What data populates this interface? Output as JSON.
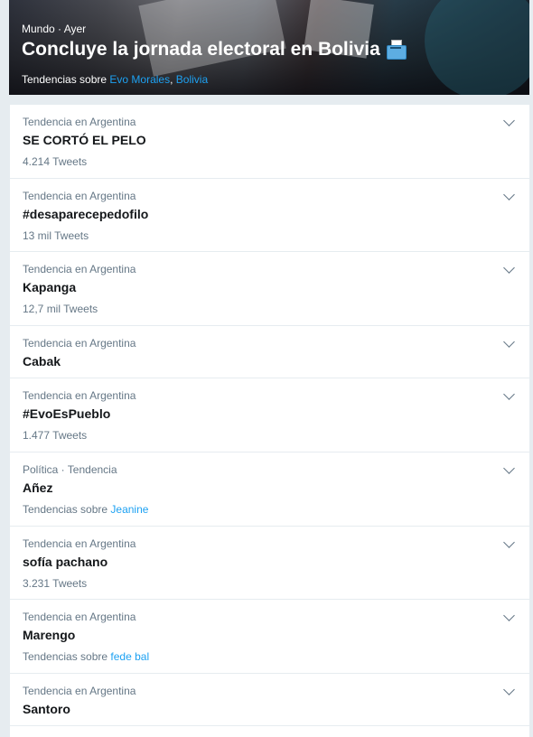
{
  "hero": {
    "category": "Mundo",
    "separator": "·",
    "time": "Ayer",
    "title": "Concluye la jornada electoral en Bolivia",
    "icon": "ballot-box-icon",
    "topics_prefix": "Tendencias sobre",
    "topic1": "Evo Morales",
    "topic_sep": ",",
    "topic2": "Bolivia"
  },
  "trends": [
    {
      "context": "Tendencia en Argentina",
      "name": "SE CORTÓ EL PELO",
      "count": "4.214 Tweets"
    },
    {
      "context": "Tendencia en Argentina",
      "name": "#desaparecepedofilo",
      "count": "13 mil Tweets"
    },
    {
      "context": "Tendencia en Argentina",
      "name": "Kapanga",
      "count": "12,7 mil Tweets"
    },
    {
      "context": "Tendencia en Argentina",
      "name": "Cabak"
    },
    {
      "context": "Tendencia en Argentina",
      "name": "#EvoEsPueblo",
      "count": "1.477 Tweets"
    },
    {
      "context": "Política · Tendencia",
      "name": "Añez",
      "about_prefix": "Tendencias sobre",
      "about_topic": "Jeanine"
    },
    {
      "context": "Tendencia en Argentina",
      "name": "sofía pachano",
      "count": "3.231 Tweets"
    },
    {
      "context": "Tendencia en Argentina",
      "name": "Marengo",
      "about_prefix": "Tendencias sobre",
      "about_topic": "fede bal"
    },
    {
      "context": "Tendencia en Argentina",
      "name": "Santoro"
    }
  ],
  "colors": {
    "link": "#1da1f2",
    "muted": "#657786",
    "background": "#e6ecf0"
  }
}
